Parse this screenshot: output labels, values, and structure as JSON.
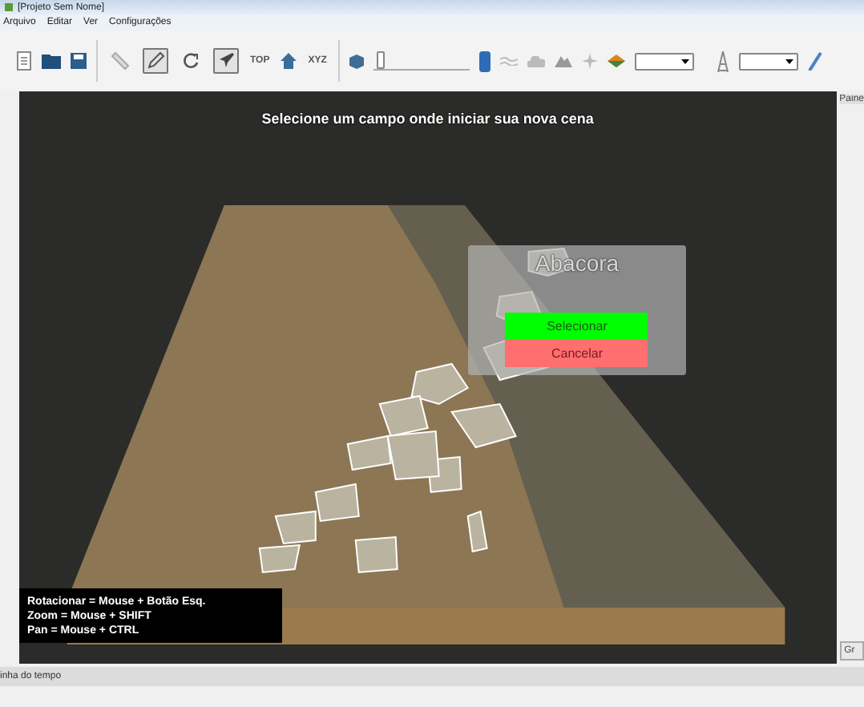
{
  "window": {
    "title": "[Projeto Sem Nome]"
  },
  "menu": [
    "Arquivo",
    "Editar",
    "Ver",
    "Configurações"
  ],
  "toolbar": {
    "view_tools": [
      {
        "selected": false
      },
      {
        "selected": true
      },
      {
        "selected": false
      },
      {
        "selected": true
      }
    ],
    "view_labels": [
      {
        "label": "TOP",
        "selected": false
      },
      {
        "label": "XYZ",
        "selected": false
      }
    ],
    "slider": {
      "level": 0.03
    }
  },
  "scene": {
    "hint": "Selecione um campo onde iniciar sua nova cena",
    "popup": {
      "title": "Abacora",
      "buttons": [
        {
          "label": "Selecionar",
          "kind": "confirm"
        },
        {
          "label": "Cancelar",
          "kind": "cancel"
        }
      ]
    },
    "help": [
      "Rotacionar = Mouse + Botão Esq.",
      "Zoom = Mouse + SHIFT",
      "Pan = Mouse + CTRL"
    ]
  },
  "right_panel": {
    "tab": "Paine",
    "button": "Gr"
  },
  "timeline": {
    "title": "inha do tempo"
  }
}
